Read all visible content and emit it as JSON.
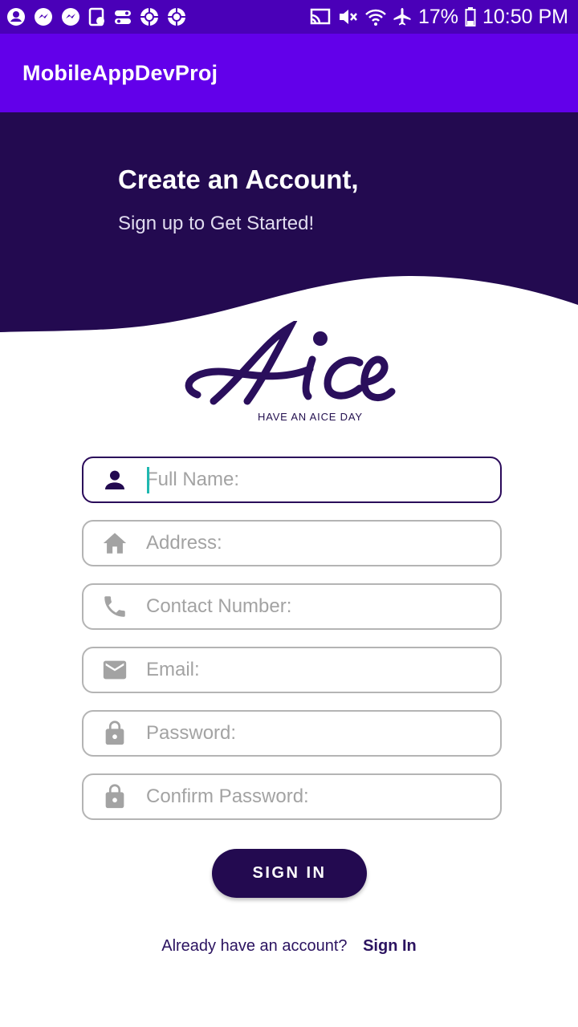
{
  "status_bar": {
    "left_icons": [
      "account-icon",
      "messenger-icon",
      "messenger-icon",
      "clipboard-icon",
      "toggle-icon",
      "aperture-icon",
      "aperture-icon"
    ],
    "right_icons": [
      "cast-icon",
      "mute-icon",
      "wifi-icon",
      "airplane-icon"
    ],
    "battery": "17%",
    "time": "10:50 PM"
  },
  "app_bar": {
    "title": "MobileAppDevProj"
  },
  "header": {
    "title": "Create an Account,",
    "subtitle": "Sign up to Get Started!"
  },
  "logo": {
    "wordmark": "Aice",
    "tagline": "HAVE AN AICE DAY"
  },
  "form": {
    "fields": [
      {
        "placeholder": "Full Name:",
        "icon": "person-icon",
        "value": "",
        "focused": true
      },
      {
        "placeholder": "Address:",
        "icon": "home-icon",
        "value": ""
      },
      {
        "placeholder": "Contact Number:",
        "icon": "phone-icon",
        "value": ""
      },
      {
        "placeholder": "Email:",
        "icon": "email-icon",
        "value": ""
      },
      {
        "placeholder": "Password:",
        "icon": "lock-icon",
        "value": ""
      },
      {
        "placeholder": "Confirm Password:",
        "icon": "lock-icon",
        "value": ""
      }
    ],
    "submit_label": "SIGN IN"
  },
  "footer": {
    "prompt": "Already have an account?",
    "link": "Sign In"
  },
  "colors": {
    "status_bar": "#4a00b8",
    "app_bar": "#6200ea",
    "header": "#230a50",
    "button": "#230a50",
    "field_border": "#b4b4b4",
    "field_focus_border": "#2a0a5a",
    "placeholder": "#a3a3a3",
    "icon_inactive": "#a3a3a3",
    "icon_active": "#230a50"
  }
}
